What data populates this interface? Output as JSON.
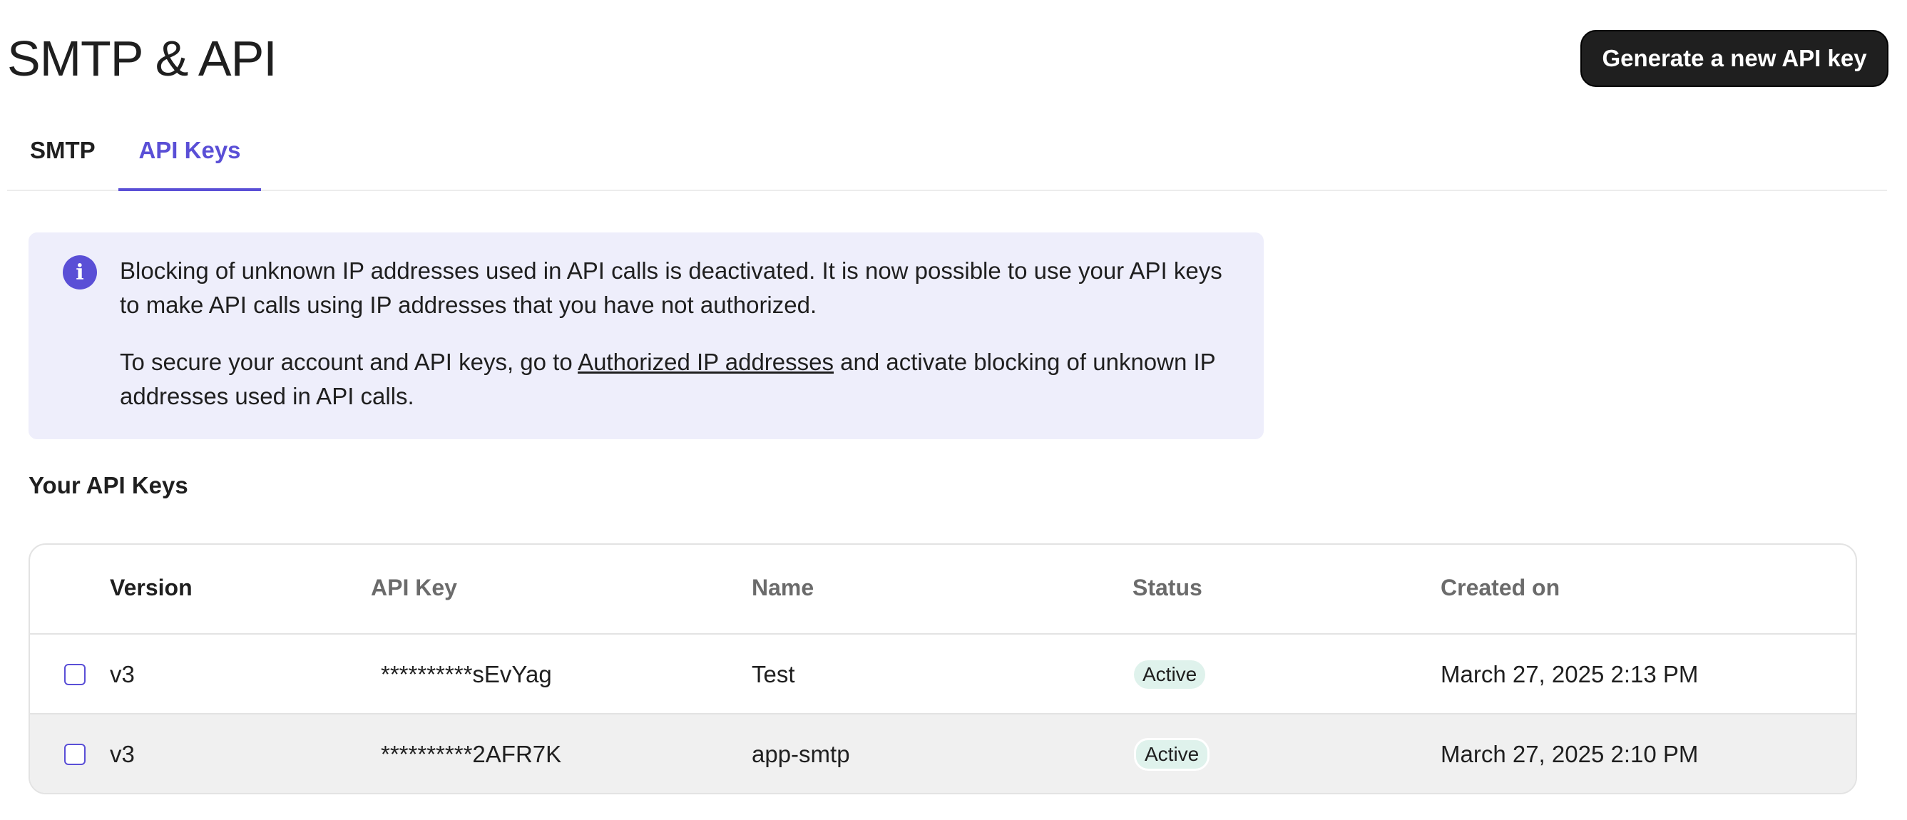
{
  "header": {
    "title": "SMTP & API",
    "generate_button_label": "Generate a new API key"
  },
  "tabs": [
    {
      "label": "SMTP",
      "active": false
    },
    {
      "label": "API Keys",
      "active": true
    }
  ],
  "banner": {
    "icon": "info-icon",
    "icon_glyph": "i",
    "paragraph1": "Blocking of unknown IP addresses used in API calls is deactivated. It is now possible to use your API keys to make API calls using IP addresses that you have not authorized.",
    "paragraph2_before": "To secure your account and API keys, go to ",
    "paragraph2_link": "Authorized IP addresses",
    "paragraph2_after": " and activate blocking of unknown IP addresses used in API calls."
  },
  "section_title": "Your API Keys",
  "table": {
    "columns": [
      "Version",
      "API Key",
      "Name",
      "Status",
      "Created on"
    ],
    "rows": [
      {
        "version": "v3",
        "api_key": "**********sEvYag",
        "name": "Test",
        "status": "Active",
        "created_on": "March 27, 2025 2:13 PM"
      },
      {
        "version": "v3",
        "api_key": "**********2AFR7K",
        "name": "app-smtp",
        "status": "Active",
        "created_on": "March 27, 2025 2:10 PM"
      }
    ]
  },
  "colors": {
    "accent": "#5a4fd6",
    "banner_bg": "#eeeefb",
    "status_badge_bg": "#dff2ec",
    "button_bg": "#1f1f1f"
  }
}
